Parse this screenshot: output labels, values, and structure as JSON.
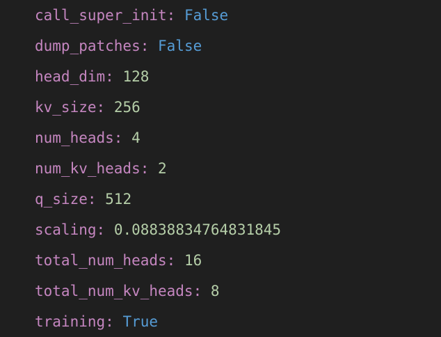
{
  "variables": [
    {
      "name": "call_super_init",
      "value": "False",
      "kind": "bool"
    },
    {
      "name": "dump_patches",
      "value": "False",
      "kind": "bool"
    },
    {
      "name": "head_dim",
      "value": "128",
      "kind": "num"
    },
    {
      "name": "kv_size",
      "value": "256",
      "kind": "num"
    },
    {
      "name": "num_heads",
      "value": "4",
      "kind": "num"
    },
    {
      "name": "num_kv_heads",
      "value": "2",
      "kind": "num"
    },
    {
      "name": "q_size",
      "value": "512",
      "kind": "num"
    },
    {
      "name": "scaling",
      "value": "0.08838834764831845",
      "kind": "num"
    },
    {
      "name": "total_num_heads",
      "value": "16",
      "kind": "num"
    },
    {
      "name": "total_num_kv_heads",
      "value": "8",
      "kind": "num"
    },
    {
      "name": "training",
      "value": "True",
      "kind": "bool"
    }
  ],
  "separator": ": ",
  "colors": {
    "background": "#1f1f1f",
    "name": "#c586c0",
    "boolean": "#569cd6",
    "number": "#b5cea8"
  }
}
